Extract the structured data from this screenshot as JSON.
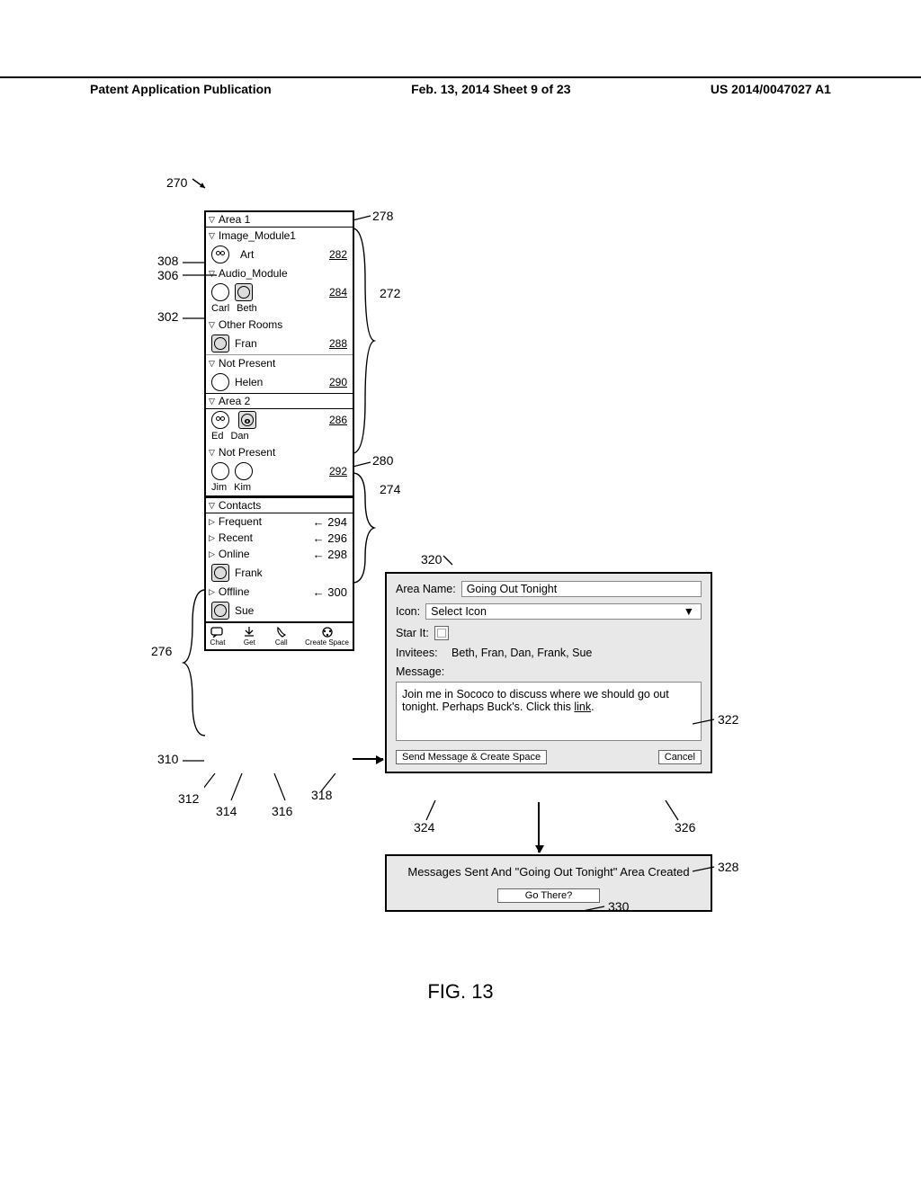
{
  "header": {
    "left": "Patent Application Publication",
    "center": "Feb. 13, 2014  Sheet 9 of 23",
    "right": "US 2014/0047027 A1"
  },
  "figure_label": "FIG. 13",
  "root_ref": "270",
  "sidebar": {
    "area1": {
      "header": "Area 1",
      "image_module": {
        "label": "Image_Module1",
        "user": "Art",
        "ref": "282"
      },
      "audio_module": {
        "label": "Audio_Module",
        "users": [
          "Carl",
          "Beth"
        ],
        "ref": "284"
      },
      "other_rooms": {
        "label": "Other Rooms",
        "user": "Fran",
        "ref": "288"
      },
      "not_present": {
        "label": "Not Present",
        "user": "Helen",
        "ref": "290"
      }
    },
    "area2": {
      "header": "Area 2",
      "users": [
        "Ed",
        "Dan"
      ],
      "ref": "286",
      "not_present": {
        "label": "Not Present",
        "users": [
          "Jim",
          "Kim"
        ],
        "ref": "292"
      }
    },
    "contacts": {
      "header": "Contacts",
      "frequent": {
        "label": "Frequent",
        "ref": "294"
      },
      "recent": {
        "label": "Recent",
        "ref": "296"
      },
      "online": {
        "label": "Online",
        "user": "Frank",
        "ref": "298"
      },
      "offline": {
        "label": "Offline",
        "user": "Sue",
        "ref": "300"
      }
    },
    "toolbar": {
      "chat": "Chat",
      "get": "Get",
      "call": "Call",
      "create": "Create Space"
    }
  },
  "left_refs": {
    "r308": "308",
    "r306": "306",
    "r302": "302",
    "r276": "276",
    "r310": "310",
    "r312": "312",
    "r314": "314",
    "r316": "316",
    "r318": "318"
  },
  "right_refs": {
    "r278": "278",
    "r272": "272",
    "r280": "280",
    "r274": "274"
  },
  "dialog": {
    "ref": "320",
    "area_name_label": "Area Name:",
    "area_name_value": "Going Out Tonight",
    "icon_label": "Icon:",
    "icon_value": "Select Icon",
    "star_label": "Star It:",
    "invitees_label": "Invitees:",
    "invitees_value": "Beth, Fran, Dan, Frank, Sue",
    "message_label": "Message:",
    "message_text": "Join me in Sococo to discuss where we should go out tonight.  Perhaps Buck's.  Click this ",
    "message_link": "link",
    "message_ref": "322",
    "send": "Send Message & Create Space",
    "send_ref": "324",
    "cancel": "Cancel",
    "cancel_ref": "326"
  },
  "confirm": {
    "text": "Messages Sent And \"Going Out Tonight\" Area Created",
    "ref": "328",
    "button": "Go There?",
    "button_ref": "330"
  }
}
